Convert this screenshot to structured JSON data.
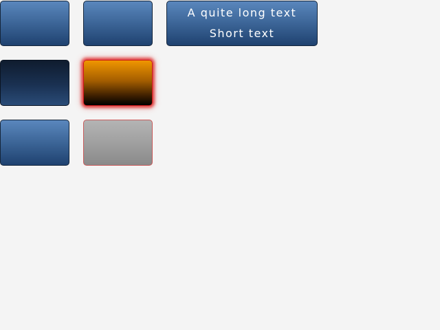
{
  "colors": {
    "background": "#f4f4f4",
    "button_blue_top": "#5a87bd",
    "button_blue_bottom": "#1f4270",
    "button_dark_top": "#0f1c2e",
    "button_orange_top": "#f09600",
    "button_orange_glow": "#dc1414",
    "button_gray": "#a0a0a0"
  },
  "text_button": {
    "line1": "A quite long text",
    "line2": "Short text"
  }
}
